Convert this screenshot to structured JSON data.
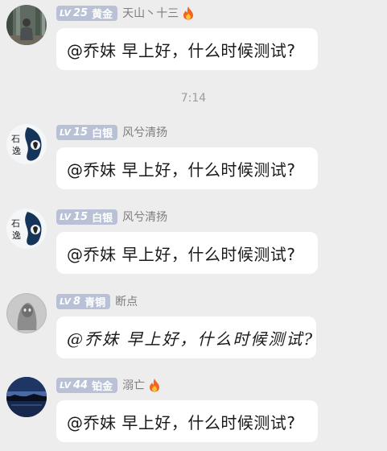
{
  "time_divider": "7:14",
  "messages": [
    {
      "level_prefix": "LV",
      "level": "25",
      "rank": "黄金",
      "nick": "天山丶十三",
      "fire_icon": "fire-icon",
      "avatar_icon": "person-in-forest-avatar",
      "text": "@乔妹 早上好，什么时候测试?"
    },
    {
      "level_prefix": "LV",
      "level": "15",
      "rank": "白银",
      "nick": "风兮清扬",
      "avatar_icon": "ink-calligraphy-avatar",
      "text": "@乔妹 早上好，什么时候测试?"
    },
    {
      "level_prefix": "LV",
      "level": "15",
      "rank": "白银",
      "nick": "风兮清扬",
      "avatar_icon": "ink-calligraphy-avatar",
      "text": "@乔妹 早上好，什么时候测试?"
    },
    {
      "level_prefix": "LV",
      "level": "8",
      "rank": "青铜",
      "nick": "断点",
      "avatar_icon": "grey-ghost-avatar",
      "text": "@乔妹 早上好，什么时候测试?"
    },
    {
      "level_prefix": "LV",
      "level": "44",
      "rank": "铂金",
      "nick": "溺亡",
      "fire_icon": "fire-icon",
      "avatar_icon": "night-lake-avatar",
      "text": "@乔妹 早上好，什么时候测试?"
    }
  ]
}
